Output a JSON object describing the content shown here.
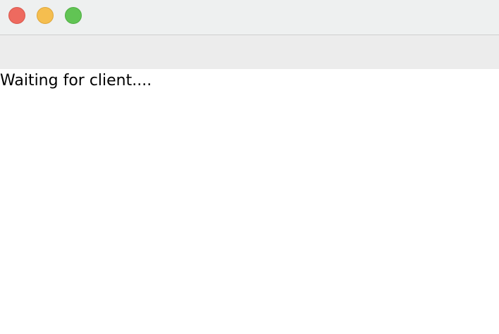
{
  "window": {
    "controls": [
      {
        "name": "close-button",
        "icon": "close-dot-icon",
        "color": "#ee6a5f",
        "border": "#d9584d"
      },
      {
        "name": "minimize-button",
        "icon": "minimize-dot-icon",
        "color": "#f5be4f",
        "border": "#dea63a"
      },
      {
        "name": "zoom-button",
        "icon": "zoom-dot-icon",
        "color": "#61c454",
        "border": "#4fae42"
      }
    ]
  },
  "content": {
    "status_text": "Waiting for client...."
  }
}
